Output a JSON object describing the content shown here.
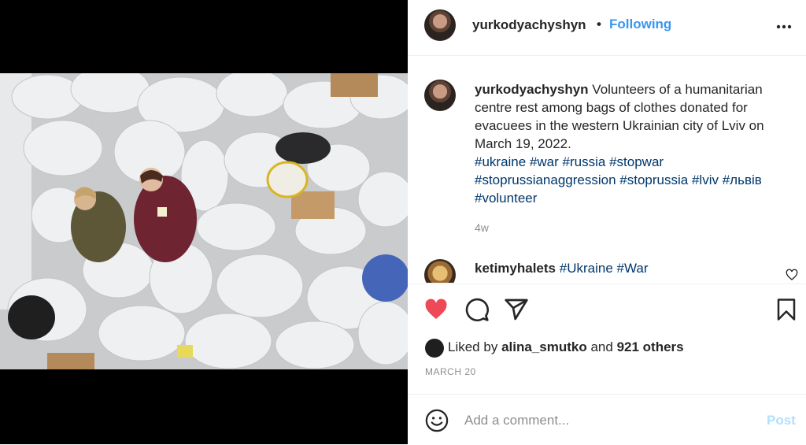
{
  "post": {
    "username": "yurkodyachyshyn",
    "separator": "•",
    "follow_status": "Following",
    "more_icon": "more-horizontal-icon"
  },
  "caption": {
    "username": "yurkodyachyshyn",
    "text": "Volunteers of a humanitarian centre rest among bags of clothes donated for evacuees in the western Ukrainian city of Lviv on March 19, 2022.",
    "hashtags": [
      "#ukraine",
      "#war",
      "#russia",
      "#stopwar",
      "#stoprussianaggression",
      "#stoprussia",
      "#lviv",
      "#львів",
      "#volunteer"
    ],
    "age": "4w"
  },
  "comment": {
    "username": "ketimyhalets",
    "hashtags": [
      "#Ukraine",
      "#War"
    ]
  },
  "actions": {
    "liked": true,
    "like_icon": "heart-filled-icon",
    "comment_icon": "comment-icon",
    "share_icon": "share-icon",
    "save_icon": "bookmark-icon",
    "like_color": "#ed4956"
  },
  "likes": {
    "prefix": "Liked by",
    "user": "alina_smutko",
    "and": "and",
    "others": "921 others"
  },
  "date": "MARCH 20",
  "add_comment": {
    "placeholder": "Add a comment...",
    "post_label": "Post",
    "emoji_icon": "smile-icon"
  },
  "colors": {
    "link_blue": "#3897f0",
    "hashtag": "#00376b",
    "muted": "#8e8e8e",
    "post_disabled": "#b2dffc"
  }
}
